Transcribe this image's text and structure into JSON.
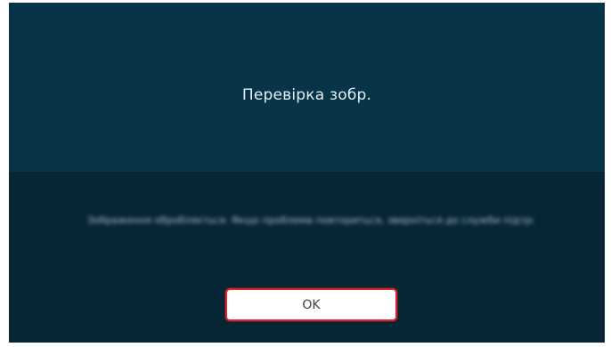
{
  "dialog": {
    "title": "Перевірка зобр.",
    "message": "Зображення обробляється. Якщо проблема повториться, зверніться до служби підтримки.",
    "ok_label": "OK"
  },
  "colors": {
    "top_panel": "#083449",
    "bottom_panel": "#062535",
    "button_focus_border": "#e0222a"
  }
}
